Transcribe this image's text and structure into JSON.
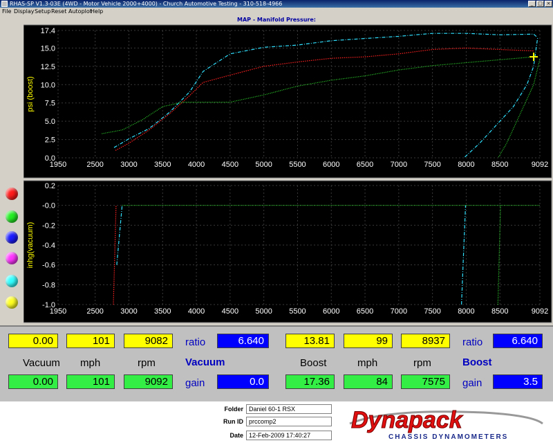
{
  "window": {
    "title": "RHAS-SP V1.3-03E  (4WD - Motor Vehicle 2000+4000) - Church Automotive Testing - 310-518-4966"
  },
  "menu": [
    "File",
    "Display",
    "Setup",
    "Reset",
    "Autoplot",
    "Help"
  ],
  "chart_title": "MAP - Manifold Pressure:",
  "colors": {
    "red": "#ff2020",
    "green": "#30e030",
    "blue": "#0000ff",
    "magenta": "#ff00ff",
    "cyan": "#30e0ff",
    "yellow": "#ffff00"
  },
  "channel_buttons": [
    {
      "name": "red-channel-button",
      "color": "#ff1a1a"
    },
    {
      "name": "green-channel-button",
      "color": "#22ee22"
    },
    {
      "name": "blue-channel-button",
      "color": "#1a1aff"
    },
    {
      "name": "magenta-channel-button",
      "color": "#ff33ff"
    },
    {
      "name": "cyan-channel-button",
      "color": "#33ffff"
    },
    {
      "name": "yellow-channel-button",
      "color": "#ffff22"
    }
  ],
  "chart_data": [
    {
      "type": "line",
      "title": "MAP - Manifold Pressure:",
      "ylabel": "psi (boost)",
      "xlabel": "",
      "xlim": [
        1950,
        9092
      ],
      "ylim": [
        0,
        17.4
      ],
      "x_ticks": [
        "1950",
        "2500",
        "3000",
        "3500",
        "4000",
        "4500",
        "5000",
        "5500",
        "6000",
        "6500",
        "7000",
        "7500",
        "8000",
        "8500",
        "9092"
      ],
      "y_ticks": [
        "17.4",
        "15.0",
        "12.5",
        "10.0",
        "7.5",
        "5.0",
        "2.5",
        "0.0"
      ],
      "grid": true,
      "series": [
        {
          "color": "red",
          "x": [
            2800,
            3000,
            3300,
            3600,
            3900,
            4100,
            4500,
            5000,
            5500,
            6000,
            6500,
            7000,
            7500,
            8000,
            8500,
            9000
          ],
          "y": [
            1.0,
            2.0,
            3.8,
            6.0,
            8.5,
            10.3,
            11.3,
            12.5,
            13.1,
            13.6,
            13.8,
            14.2,
            14.8,
            15.0,
            14.8,
            14.6
          ]
        },
        {
          "color": "cyan",
          "x": [
            2780,
            3000,
            3300,
            3600,
            3900,
            4100,
            4500,
            5000,
            5500,
            6000,
            6500,
            7000,
            7500,
            8000,
            8500,
            9000,
            9050
          ],
          "y": [
            1.4,
            2.6,
            4.0,
            6.2,
            9.0,
            11.8,
            14.2,
            15.1,
            15.4,
            16.0,
            16.3,
            16.6,
            17.0,
            17.0,
            16.8,
            16.9,
            16.5
          ]
        },
        {
          "color": "green",
          "x": [
            2600,
            2900,
            3200,
            3500,
            3800,
            4000,
            4500,
            5000,
            5500,
            6000,
            6500,
            7000,
            7500,
            8000,
            8500,
            9000
          ],
          "y": [
            3.3,
            3.8,
            5.2,
            7.0,
            7.6,
            7.6,
            7.6,
            8.6,
            9.8,
            10.6,
            11.2,
            12.0,
            12.6,
            13.0,
            13.4,
            13.8
          ]
        },
        {
          "color": "cyan",
          "x": [
            7980,
            8200,
            8500,
            8700,
            8900,
            9000,
            9060
          ],
          "y": [
            0.1,
            2.0,
            5.0,
            7.0,
            10.0,
            12.5,
            16.5
          ]
        },
        {
          "color": "green",
          "x": [
            8480,
            8600,
            8800,
            9000,
            9092
          ],
          "y": [
            0.1,
            2.0,
            6.0,
            10.0,
            13.5
          ]
        }
      ]
    },
    {
      "type": "line",
      "ylabel": "inhg(vacuum)",
      "xlabel": "",
      "xlim": [
        1950,
        9092
      ],
      "ylim": [
        -1.0,
        0.2
      ],
      "x_ticks": [
        "1950",
        "2500",
        "3000",
        "3500",
        "4000",
        "4500",
        "5000",
        "5500",
        "6000",
        "6500",
        "7000",
        "7500",
        "8000",
        "8500",
        "9092"
      ],
      "y_ticks": [
        "0.2",
        "-0.0",
        "-0.2",
        "-0.4",
        "-0.6",
        "-0.8",
        "-1.0"
      ],
      "grid": true,
      "series": [
        {
          "color": "red",
          "x": [
            2770,
            2790,
            2810
          ],
          "y": [
            -1.0,
            -0.5,
            0.0
          ]
        },
        {
          "color": "cyan",
          "x": [
            2820,
            2860,
            2900
          ],
          "y": [
            -0.6,
            -0.3,
            0.0
          ]
        },
        {
          "color": "green",
          "x": [
            2900,
            9092
          ],
          "y": [
            0.0,
            0.0
          ]
        },
        {
          "color": "cyan",
          "x": [
            7930,
            7960,
            7990
          ],
          "y": [
            -1.0,
            -0.5,
            0.0
          ]
        },
        {
          "color": "green",
          "x": [
            8470,
            8490,
            8510
          ],
          "y": [
            -1.0,
            -0.5,
            0.0
          ]
        }
      ]
    }
  ],
  "readout": {
    "left_top": [
      "0.00",
      "101",
      "9082"
    ],
    "left_headers": [
      "Vacuum",
      "mph",
      "rpm"
    ],
    "left_bottom": [
      "0.00",
      "101",
      "9092"
    ],
    "left_ratio_label": "ratio",
    "left_ratio_value": "6.640",
    "left_mode_label": "Vacuum",
    "left_gain_label": "gain",
    "left_gain_value": "0.0",
    "right_top": [
      "13.81",
      "99",
      "8937"
    ],
    "right_headers": [
      "Boost",
      "mph",
      "rpm"
    ],
    "right_bottom": [
      "17.36",
      "84",
      "7575"
    ],
    "right_ratio_label": "ratio",
    "right_ratio_value": "6.640",
    "right_mode_label": "Boost",
    "right_gain_label": "gain",
    "right_gain_value": "3.5"
  },
  "footer": {
    "folder_label": "Folder",
    "folder_value": "Daniel 60-1 RSX",
    "runid_label": "Run ID",
    "runid_value": "prccomp2",
    "date_label": "Date",
    "date_value": "12-Feb-2009  17:40:27",
    "logo_text": "Dynapack",
    "logo_sub": "CHASSIS DYNAMOMETERS"
  }
}
